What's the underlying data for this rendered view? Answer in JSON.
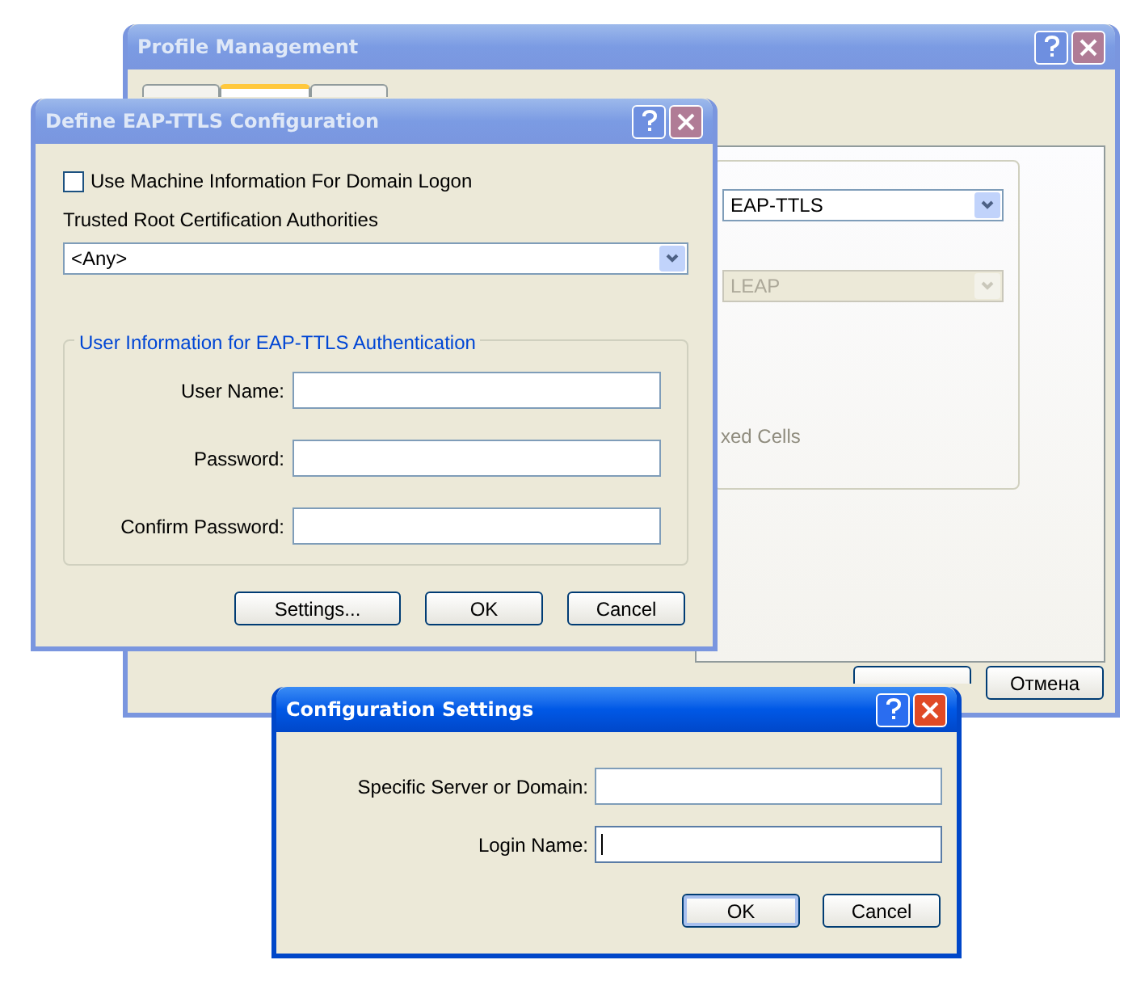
{
  "profile_window": {
    "title": "Profile Management",
    "active": false,
    "tabs": [
      {
        "selected": false
      },
      {
        "selected": true
      },
      {
        "selected": false
      }
    ],
    "eap_type": "EAP-TTLS",
    "inner_method": {
      "value": "LEAP",
      "disabled": true
    },
    "partial_label": "xed Cells",
    "buttons": [
      "Отмена"
    ]
  },
  "eap_window": {
    "title": "Define EAP-TTLS Configuration",
    "active": false,
    "use_machine_info": {
      "label": "Use Machine Information For Domain Logon",
      "checked": false
    },
    "trusted_root_label": "Trusted Root Certification Authorities",
    "trusted_root_value": "<Any>",
    "group_title": "User Information for EAP-TTLS Authentication",
    "fields": [
      {
        "label": "User Name:"
      },
      {
        "label": "Password:"
      },
      {
        "label": "Confirm Password:"
      }
    ],
    "buttons": [
      "Settings...",
      "OK",
      "Cancel"
    ]
  },
  "config_window": {
    "title": "Configuration Settings",
    "active": true,
    "fields": [
      {
        "label": "Specific Server or Domain:",
        "focused": false
      },
      {
        "label": "Login Name:",
        "focused": true
      }
    ],
    "buttons": [
      "OK",
      "Cancel"
    ]
  }
}
